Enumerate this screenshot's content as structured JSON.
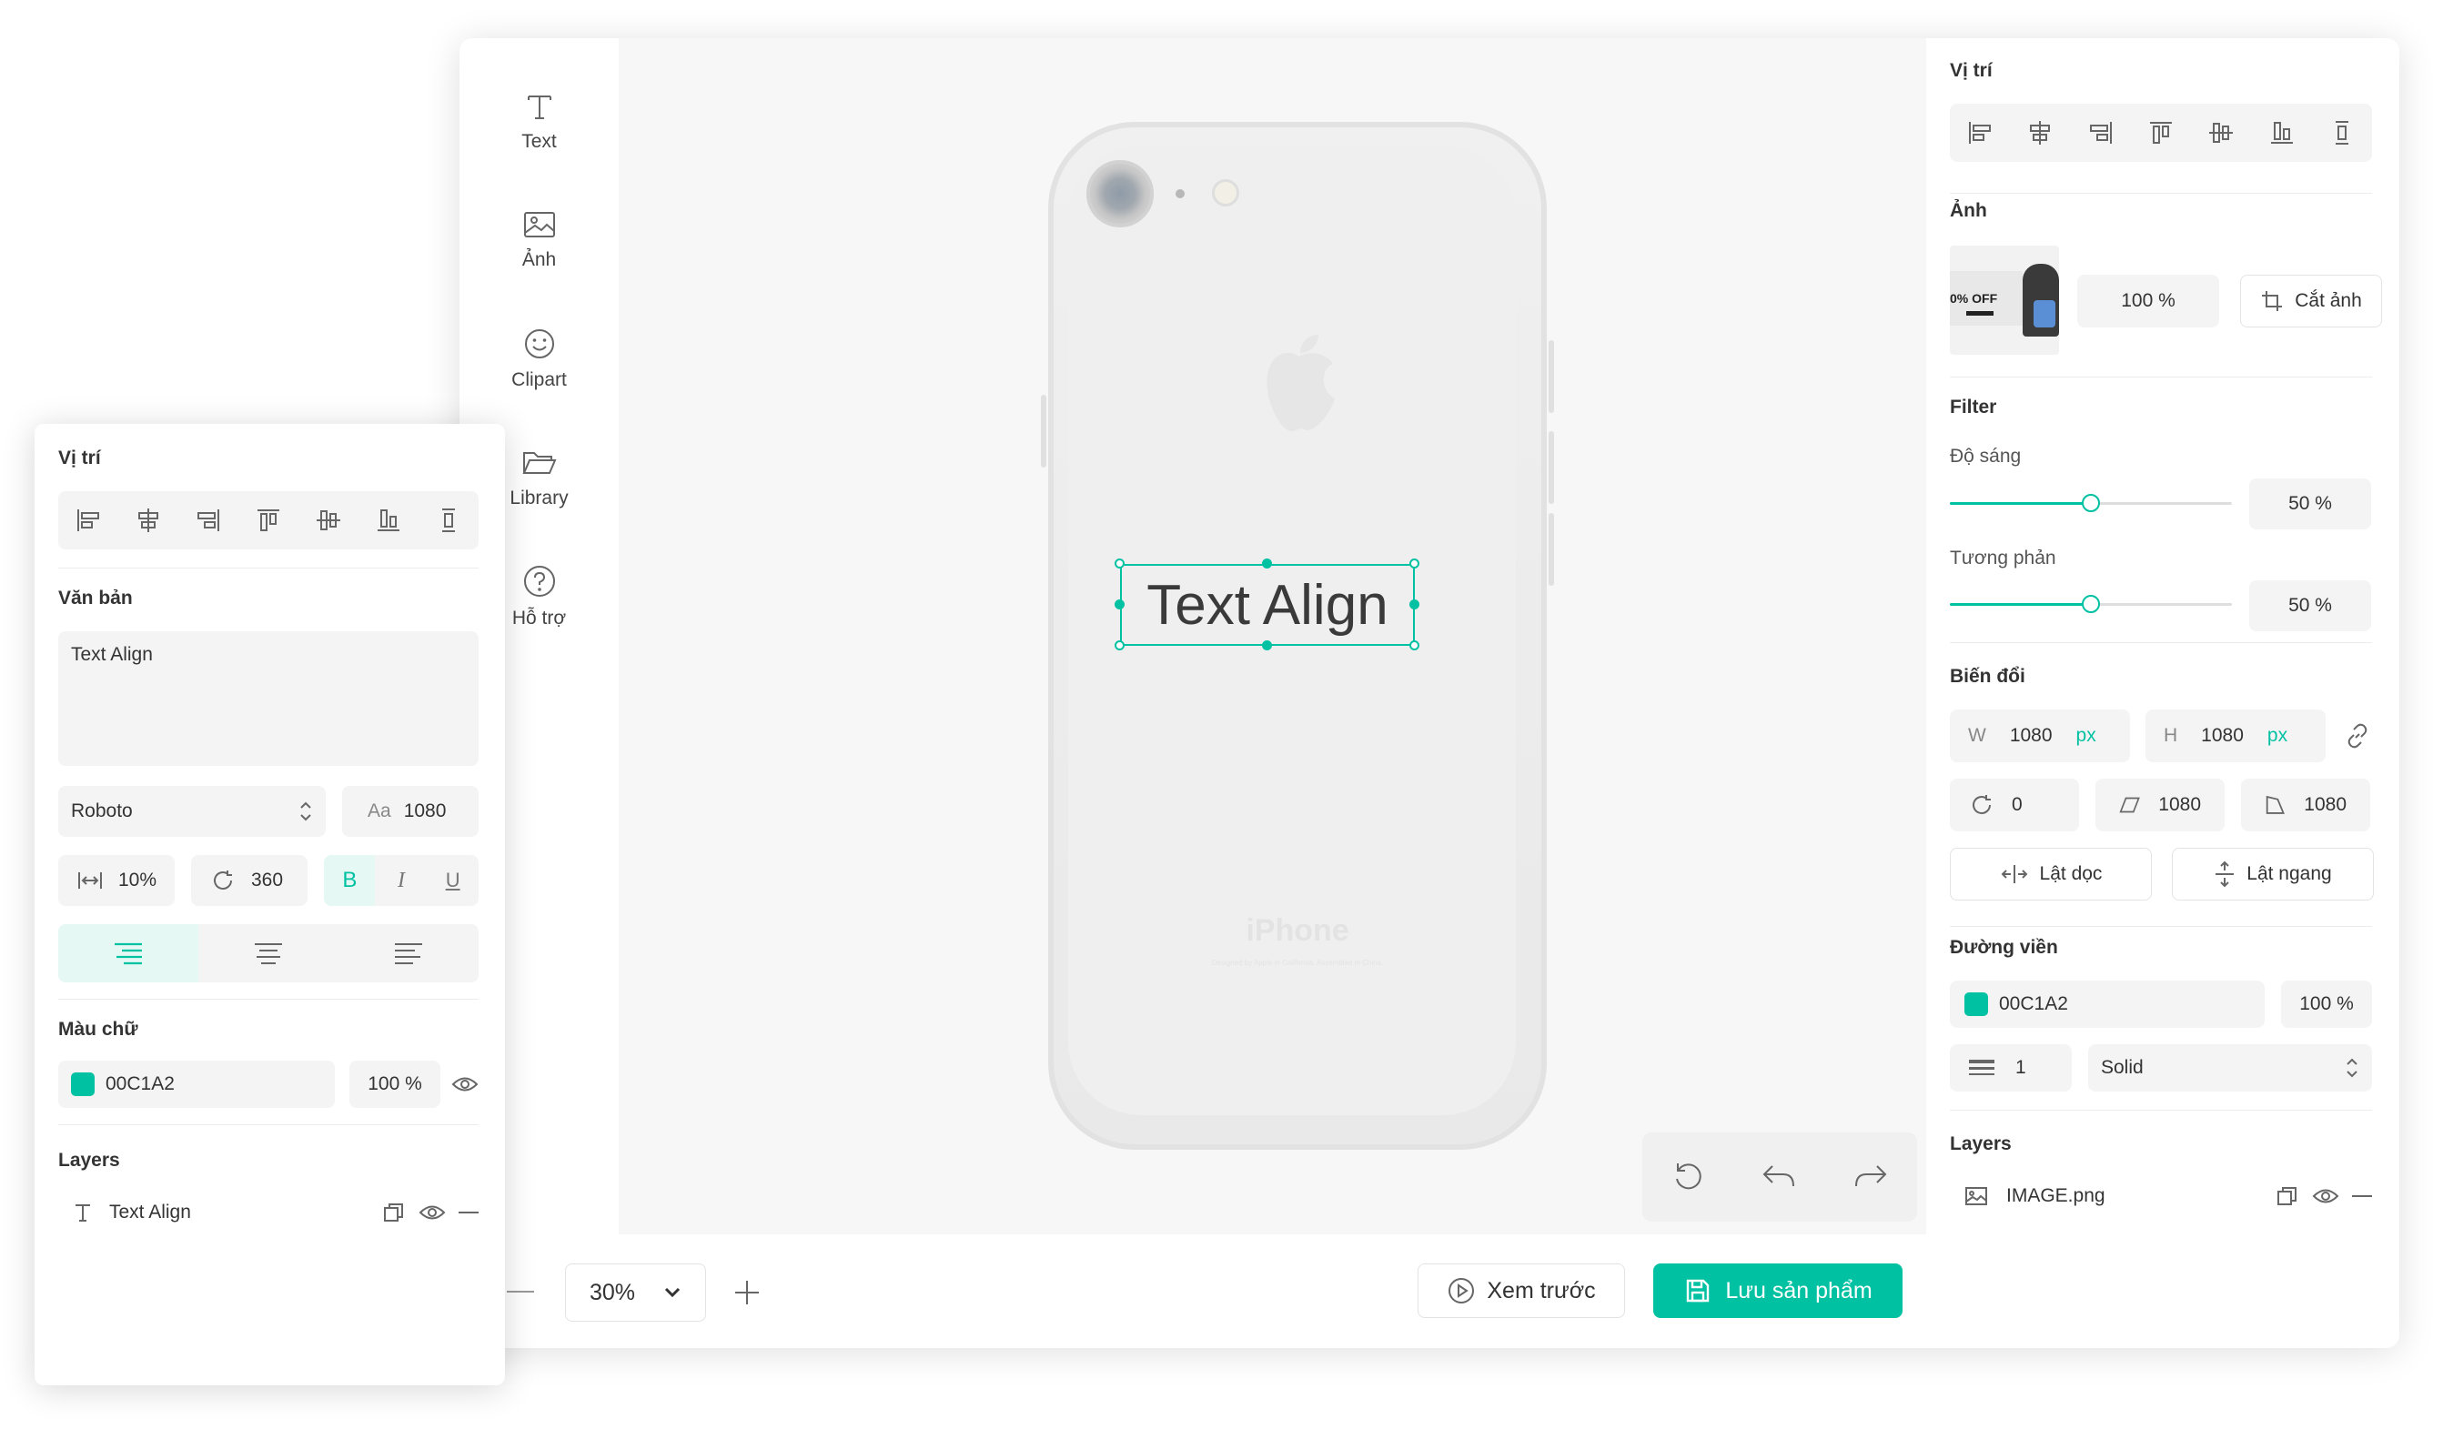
{
  "tools": [
    {
      "label": "Text",
      "icon": "text-icon"
    },
    {
      "label": "Ảnh",
      "icon": "image-icon"
    },
    {
      "label": "Clipart",
      "icon": "smiley-icon"
    },
    {
      "label": "Library",
      "icon": "folder-icon"
    },
    {
      "label": "Hỗ trợ",
      "icon": "help-icon"
    }
  ],
  "canvas": {
    "text_layer": "Text Align",
    "phone_brand": "iPhone",
    "phone_fineprint": "Designed by Apple in California. Assembled in China."
  },
  "history": {
    "reset_icon": "reset-icon",
    "undo_icon": "undo-icon",
    "redo_icon": "redo-icon"
  },
  "bottom": {
    "zoom": "30%",
    "preview_label": "Xem trước",
    "save_label": "Lưu sản phẩm"
  },
  "right": {
    "position_title": "Vị trí",
    "image_title": "Ảnh",
    "image_scale": "100 %",
    "crop_label": "Cắt ảnh",
    "thumb_text": "0% OFF",
    "filter_title": "Filter",
    "brightness_label": "Độ sáng",
    "brightness_value": "50 %",
    "brightness_level": 0.5,
    "contrast_label": "Tương phản",
    "contrast_value": "50 %",
    "contrast_level": 0.5,
    "transform_title": "Biến đổi",
    "w_label": "W",
    "w_value": "1080",
    "w_unit": "px",
    "h_label": "H",
    "h_value": "1080",
    "h_unit": "px",
    "rotate_value": "0",
    "skew_value": "1080",
    "perspective_value": "1080",
    "flip_v_label": "Lật dọc",
    "flip_h_label": "Lật ngang",
    "border_title": "Đường viền",
    "border_color": "00C1A2",
    "border_opacity": "100 %",
    "border_width": "1",
    "border_style": "Solid",
    "layers_title": "Layers",
    "layer_name": "IMAGE.png"
  },
  "float": {
    "position_title": "Vị trí",
    "text_title": "Văn bản",
    "text_value": "Text Align",
    "font": "Roboto",
    "size_label": "Aa",
    "size_value": "1080",
    "spacing_value": "10%",
    "rotate_value": "360",
    "bold": "B",
    "italic": "I",
    "underline": "U",
    "color_title": "Màu chữ",
    "color_value": "00C1A2",
    "color_opacity": "100 %",
    "layers_title": "Layers",
    "layer_name": "Text Align"
  },
  "colors": {
    "accent": "#00c1a2"
  }
}
